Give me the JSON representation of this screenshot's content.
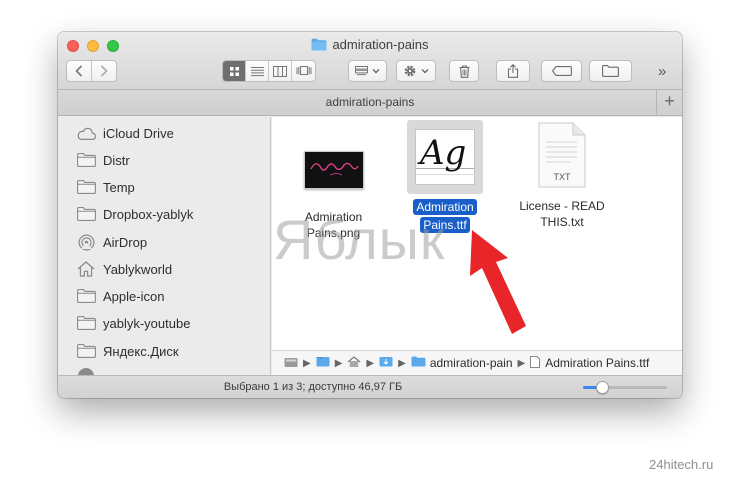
{
  "window": {
    "title": "admiration-pains",
    "tab_title": "admiration-pains",
    "tab_plus": "+",
    "more_toolbar": "»"
  },
  "sidebar": {
    "items": [
      {
        "label": "iCloud Drive",
        "icon": "cloud-icon"
      },
      {
        "label": "Distr",
        "icon": "folder-icon"
      },
      {
        "label": "Temp",
        "icon": "folder-icon"
      },
      {
        "label": "Dropbox-yablyk",
        "icon": "folder-icon"
      },
      {
        "label": "AirDrop",
        "icon": "airdrop-icon"
      },
      {
        "label": "Yablykworld",
        "icon": "home-icon"
      },
      {
        "label": "Apple-icon",
        "icon": "folder-icon"
      },
      {
        "label": "yablyk-youtube",
        "icon": "folder-icon"
      },
      {
        "label": "Яндекс.Диск",
        "icon": "folder-icon"
      }
    ]
  },
  "files": [
    {
      "name_line1": "Admiration",
      "name_line2": "Pains.png",
      "selected": false,
      "thumb": "png-thumbnail"
    },
    {
      "name_line1": "Admiration",
      "name_line2": "Pains.ttf",
      "selected": true,
      "thumb": "font-thumbnail",
      "thumb_text": "Ag"
    },
    {
      "name_line1": "License - READ",
      "name_line2": "THIS.txt",
      "selected": false,
      "thumb": "text-document",
      "thumb_text": "TXT"
    }
  ],
  "pathbar": {
    "folder": "admiration-pain",
    "file": "Admiration Pains.ttf"
  },
  "status": {
    "text": "Выбрано 1 из 3; доступно 46,97 ГБ",
    "zoom_fraction": 0.18
  },
  "overlay": {
    "watermark": "Яблык",
    "credit": "24hitech.ru",
    "arrow_color": "#e8262a"
  },
  "colors": {
    "selection": "#1a5ec9",
    "folder": "#5aa9ea"
  }
}
